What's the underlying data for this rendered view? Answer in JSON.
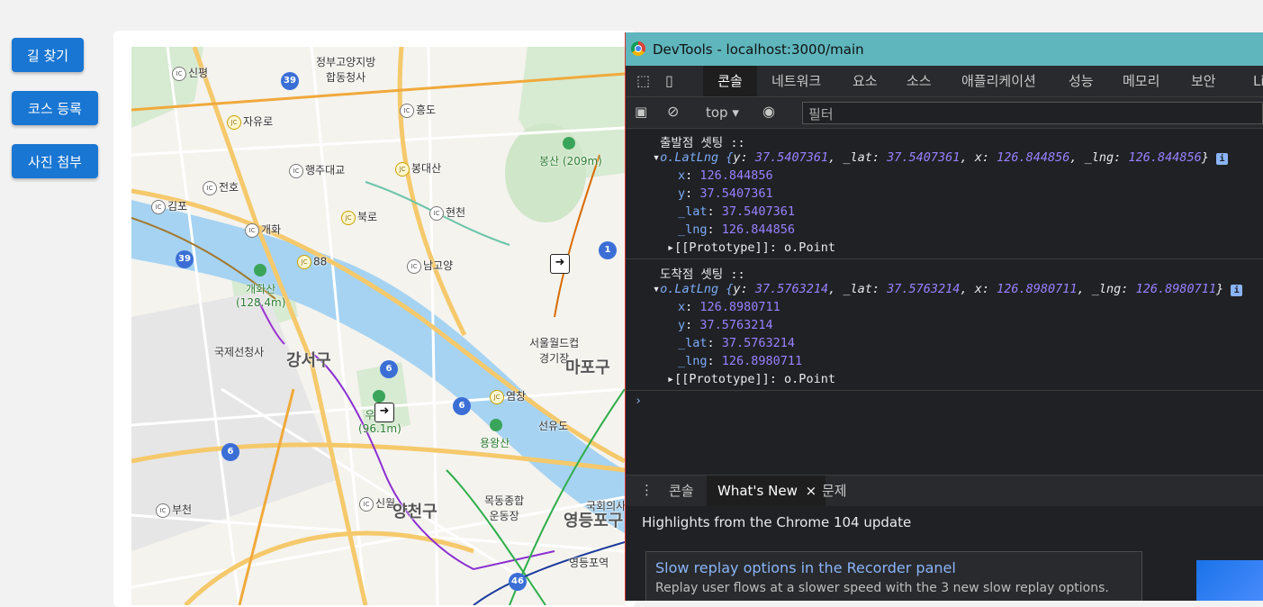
{
  "sidebar": {
    "buttons": [
      "길 찾기",
      "코스 등록",
      "사진 첨부"
    ]
  },
  "map": {
    "labels": {
      "jeongbu": "정부고양지방\n합동청사",
      "sinpyeong": "신평",
      "jayuro": "자유로",
      "heungdo": "흥도",
      "bongsan": "봉산 (209m)",
      "haengju": "행주대교",
      "bongdaesan": "봉대산",
      "jeonho": "전호",
      "gimpo": "김포",
      "hyeoncheon": "현천",
      "bukro": "북로",
      "gaehwa": "개화",
      "namgoyang": "남고양",
      "jc88": "88",
      "gaehwasan": "개화산\n(128.4m)",
      "worldcup": "서울월드컵\n경기장",
      "airport": "국제선청사",
      "gangseo": "강서구",
      "mapo": "마포구",
      "yeomchang": "염창",
      "ujangsan": "우장산\n(96.1m)",
      "seonyudo": "선유도",
      "yongwangsan": "용왕산",
      "mokdong": "목동종합\n운동장",
      "assembly": "국회의사",
      "sinwol": "신월",
      "yangcheon": "양천구",
      "bucheon": "부천",
      "yeongdeungpo": "영등포구",
      "ydp_station": "영등포역"
    },
    "shields": [
      "39",
      "39",
      "1",
      "6",
      "6",
      "6",
      "46"
    ]
  },
  "devtools": {
    "window_title": "DevTools - localhost:3000/main",
    "tabs": [
      "콘솔",
      "네트워크",
      "요소",
      "소스",
      "애플리케이션",
      "성능",
      "메모리",
      "보안",
      "Li"
    ],
    "context": "top",
    "filter_placeholder": "필터",
    "console": {
      "start_label": "출발점 셋팅 ::",
      "start_obj": {
        "summary_prefix": "o.LatLng {",
        "y_key": "y",
        "y": "37.5407361",
        "lat_key": "_lat",
        "lat": "37.5407361",
        "x_key": "x",
        "x": "126.844856",
        "lng_key": "_lng",
        "lng": "126.844856",
        "proto": "[[Prototype]]: o.Point"
      },
      "end_label": "도착점 셋팅 ::",
      "end_obj": {
        "summary_prefix": "o.LatLng {",
        "y_key": "y",
        "y": "37.5763214",
        "lat_key": "_lat",
        "lat": "37.5763214",
        "x_key": "x",
        "x": "126.8980711",
        "lng_key": "_lng",
        "lng": "126.8980711",
        "proto": "[[Prototype]]: o.Point"
      }
    },
    "drawer_tabs": [
      "콘솔",
      "What's New",
      "문제"
    ],
    "whats_new": {
      "heading": "Highlights from the Chrome 104 update",
      "card_title": "Slow replay options in the Recorder panel",
      "card_body": "Replay user flows at a slower speed with the 3 new slow replay options."
    }
  }
}
